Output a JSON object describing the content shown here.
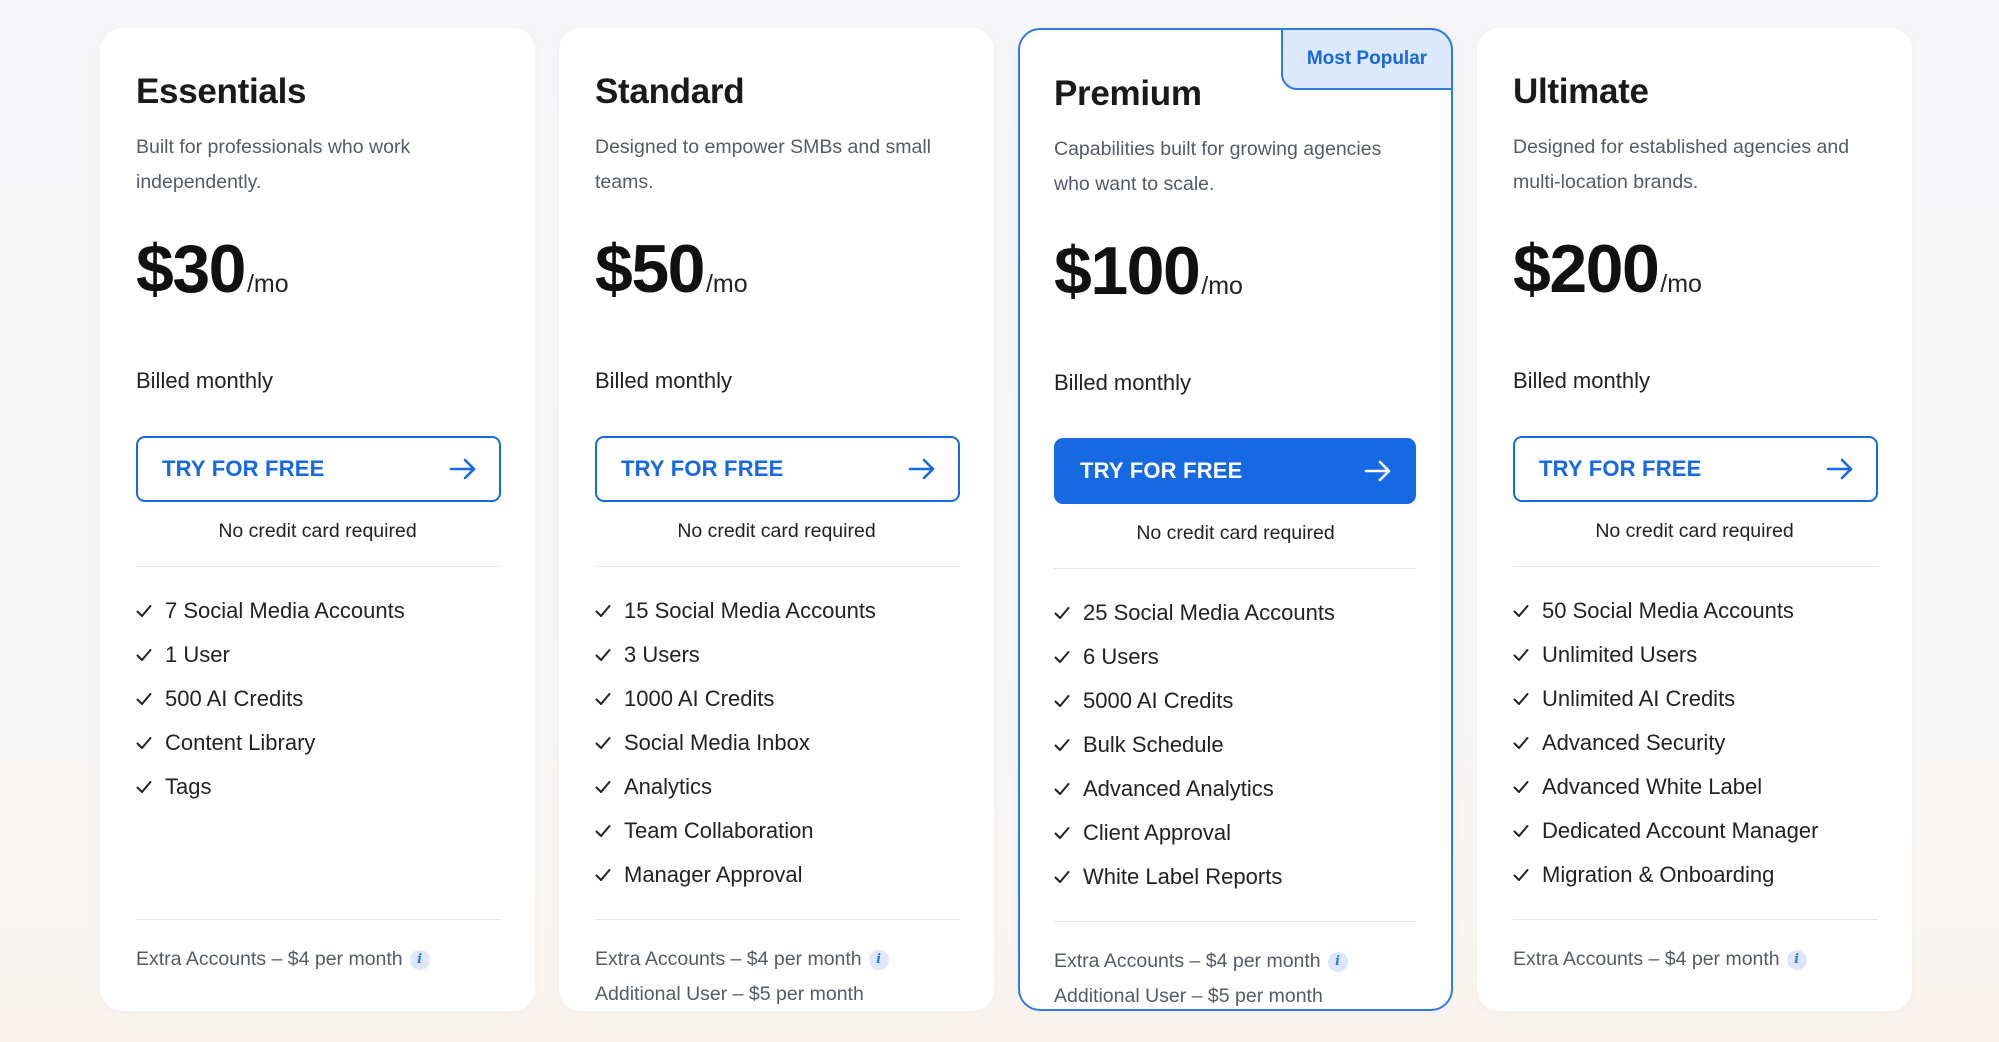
{
  "colors": {
    "accent": "#1668e3",
    "badge_bg": "#dbe9fb",
    "featured_border": "#2f7be6"
  },
  "plans": [
    {
      "name": "Essentials",
      "description": "Built for professionals who work independently.",
      "price": "$30",
      "period": "/mo",
      "billing": "Billed monthly",
      "cta_label": "TRY FOR FREE",
      "cta_note": "No credit card required",
      "features": [
        "7 Social Media Accounts",
        "1 User",
        "500 AI Credits",
        "Content Library",
        "Tags"
      ],
      "extras": [
        "Extra Accounts – $4 per month"
      ]
    },
    {
      "name": "Standard",
      "description": "Designed to empower SMBs and small teams.",
      "price": "$50",
      "period": "/mo",
      "billing": "Billed monthly",
      "cta_label": "TRY FOR FREE",
      "cta_note": "No credit card required",
      "features": [
        "15 Social Media Accounts",
        "3 Users",
        "1000 AI Credits",
        "Social Media Inbox",
        "Analytics",
        "Team Collaboration",
        "Manager Approval"
      ],
      "extras": [
        "Extra Accounts – $4 per month",
        "Additional User – $5 per month"
      ]
    },
    {
      "name": "Premium",
      "badge": "Most Popular",
      "description": "Capabilities built for growing agencies who want to scale.",
      "price": "$100",
      "period": "/mo",
      "billing": "Billed monthly",
      "cta_label": "TRY FOR FREE",
      "cta_note": "No credit card required",
      "features": [
        "25 Social Media Accounts",
        "6 Users",
        "5000 AI Credits",
        "Bulk Schedule",
        "Advanced Analytics",
        "Client Approval",
        "White Label Reports"
      ],
      "extras": [
        "Extra Accounts – $4 per month",
        "Additional User – $5 per month"
      ]
    },
    {
      "name": "Ultimate",
      "description": "Designed for established agencies and multi-location brands.",
      "price": "$200",
      "period": "/mo",
      "billing": "Billed monthly",
      "cta_label": "TRY FOR FREE",
      "cta_note": "No credit card required",
      "features": [
        "50 Social Media Accounts",
        "Unlimited Users",
        "Unlimited AI Credits",
        "Advanced Security",
        "Advanced White Label",
        "Dedicated Account Manager",
        "Migration & Onboarding"
      ],
      "extras": [
        "Extra Accounts – $4 per month"
      ]
    }
  ]
}
